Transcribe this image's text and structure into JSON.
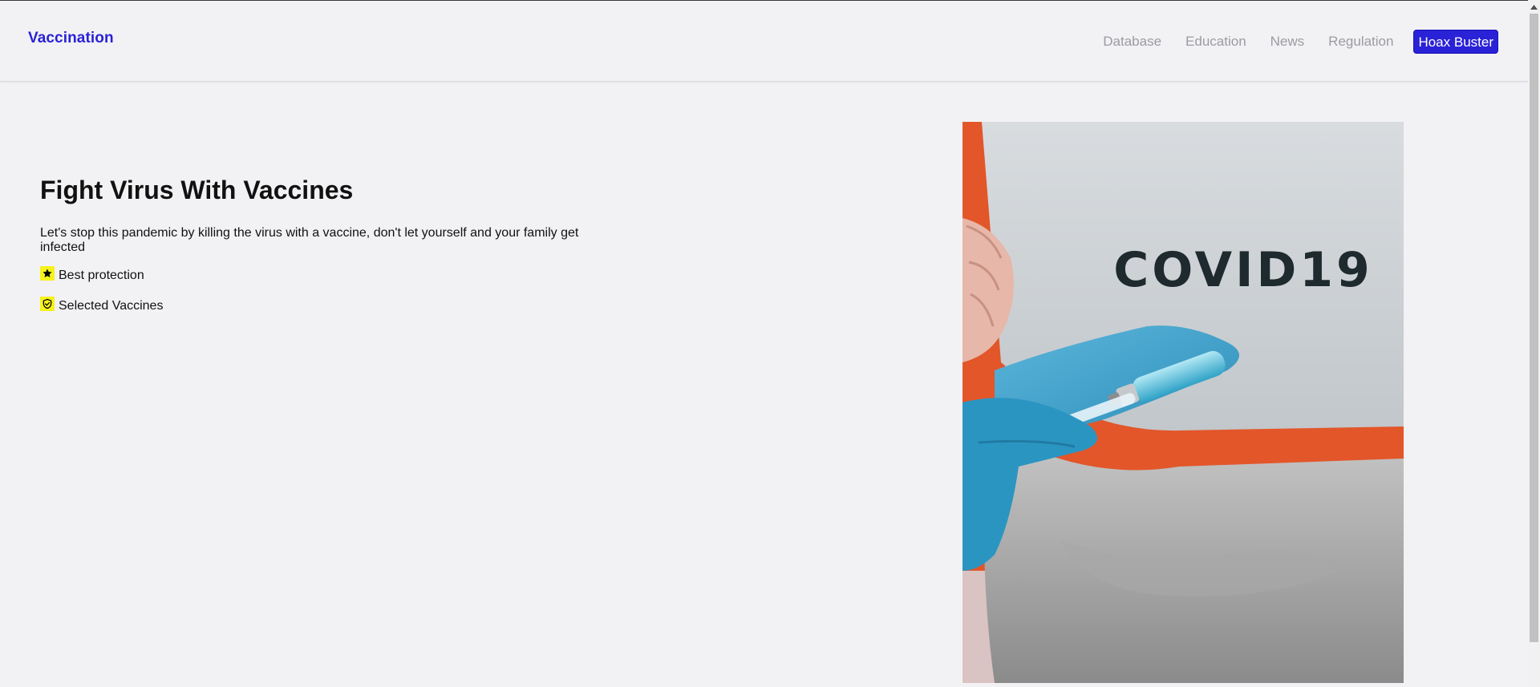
{
  "navbar": {
    "brand": "Vaccination",
    "links": [
      "Database",
      "Education",
      "News",
      "Regulation"
    ],
    "cta": "Hoax Buster"
  },
  "hero": {
    "title": "Fight Virus With Vaccines",
    "description": "Let's stop this pandemic by killing the virus with a vaccine, don't let yourself and your family get infected",
    "features": [
      {
        "label": "Best protection",
        "icon": "star-icon"
      },
      {
        "label": "Selected Vaccines",
        "icon": "shield-check-icon"
      }
    ],
    "image": {
      "sign_text": "COVID19",
      "icon": "covid-vaccine-photo"
    }
  },
  "colors": {
    "accent": "#2a22d6",
    "feature_icon_bg": "#f6f21b",
    "background": "#f2f2f4"
  }
}
